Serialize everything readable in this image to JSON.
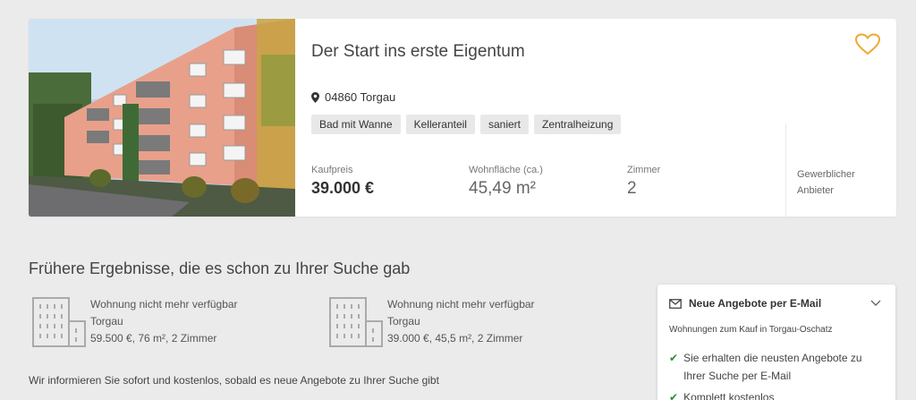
{
  "listing": {
    "title": "Der Start ins erste Eigentum",
    "location": "04860 Torgau",
    "tags": [
      "Bad mit Wanne",
      "Kelleranteil",
      "saniert",
      "Zentralheizung"
    ],
    "price_label": "Kaufpreis",
    "price_value": "39.000 €",
    "area_label": "Wohnfläche (ca.)",
    "area_value": "45,49 m²",
    "rooms_label": "Zimmer",
    "rooms_value": "2",
    "provider_line1": "Gewerblicher",
    "provider_line2": "Anbieter",
    "favorite_icon": "heart-outline-icon",
    "accent_color": "#f0a830"
  },
  "previous": {
    "title": "Frühere Ergebnisse, die es schon zu Ihrer Suche gab",
    "items": [
      {
        "status": "Wohnung nicht mehr verfügbar",
        "city": "Torgau",
        "details": "59.500 €, 76 m², 2 Zimmer"
      },
      {
        "status": "Wohnung nicht mehr verfügbar",
        "city": "Torgau",
        "details": "39.000 €, 45,5 m², 2 Zimmer"
      }
    ],
    "inform_text": "Wir informieren Sie sofort und kostenlos, sobald es neue Angebote zu Ihrer Suche gibt"
  },
  "alert": {
    "title": "Neue Angebote per E-Mail",
    "subtitle": "Wohnungen zum Kauf in Torgau-Oschatz",
    "benefits": [
      "Sie erhalten die neusten Angebote zu Ihrer Suche per E-Mail",
      "Komplett kostenlos"
    ],
    "check_color": "#2e8a2e"
  }
}
